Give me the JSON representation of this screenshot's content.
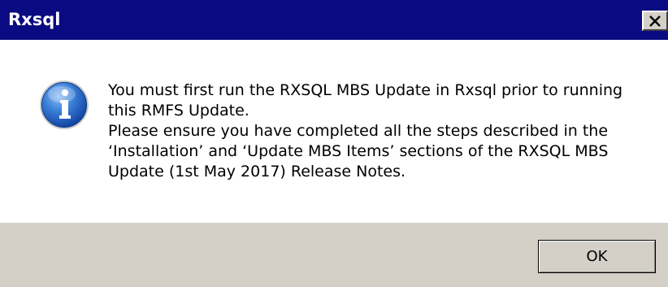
{
  "window": {
    "title": "Rxsql",
    "close_icon": "close-icon"
  },
  "message": {
    "icon": "info-icon",
    "lines": [
      "You must first run the RXSQL MBS Update in Rxsql prior to running",
      "this RMFS Update.",
      "Please ensure you have completed all the steps described in the",
      "‘Installation’ and ‘Update MBS Items’ sections of the RXSQL MBS",
      "Update (1st May 2017) Release Notes."
    ]
  },
  "buttons": {
    "ok_label": "OK"
  }
}
